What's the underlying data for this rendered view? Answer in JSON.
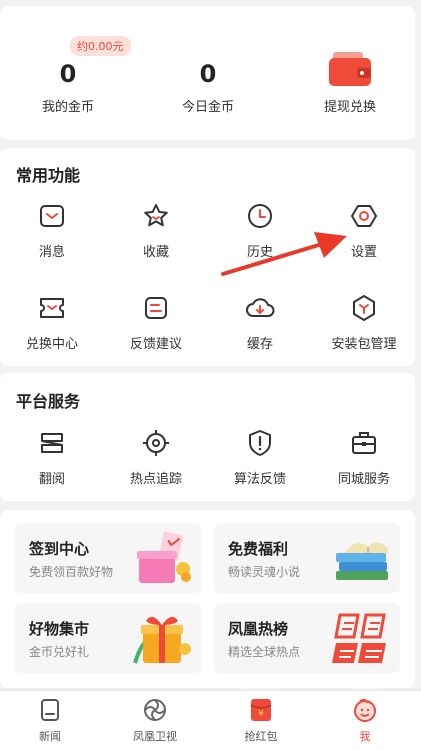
{
  "wallet": {
    "badge": "约0.00元",
    "my_coins_value": "0",
    "my_coins_label": "我的金币",
    "today_coins_value": "0",
    "today_coins_label": "今日金币",
    "withdraw_label": "提现兑换"
  },
  "common": {
    "title": "常用功能",
    "items": [
      {
        "label": "消息",
        "icon": "message-icon"
      },
      {
        "label": "收藏",
        "icon": "star-icon"
      },
      {
        "label": "历史",
        "icon": "clock-icon"
      },
      {
        "label": "设置",
        "icon": "gear-icon"
      },
      {
        "label": "兑换中心",
        "icon": "ticket-icon"
      },
      {
        "label": "反馈建议",
        "icon": "feedback-icon"
      },
      {
        "label": "缓存",
        "icon": "cloud-download-icon"
      },
      {
        "label": "安装包管理",
        "icon": "package-icon"
      }
    ]
  },
  "platform": {
    "title": "平台服务",
    "items": [
      {
        "label": "翻阅",
        "icon": "browse-icon"
      },
      {
        "label": "热点追踪",
        "icon": "target-icon"
      },
      {
        "label": "算法反馈",
        "icon": "shield-alert-icon"
      },
      {
        "label": "同城服务",
        "icon": "briefcase-icon"
      }
    ]
  },
  "promos": [
    {
      "title": "签到中心",
      "subtitle": "免费领百款好物"
    },
    {
      "title": "免费福利",
      "subtitle": "畅读灵魂小说"
    },
    {
      "title": "好物集市",
      "subtitle": "金币兑好礼"
    },
    {
      "title": "凤凰热榜",
      "subtitle": "精选全球热点"
    }
  ],
  "tabbar": {
    "items": [
      {
        "label": "新闻"
      },
      {
        "label": "凤凰卫视"
      },
      {
        "label": "抢红包"
      },
      {
        "label": "我"
      }
    ]
  },
  "colors": {
    "accent": "#f04b3a",
    "icon_stroke": "#333333",
    "background": "#f2f2f2"
  }
}
